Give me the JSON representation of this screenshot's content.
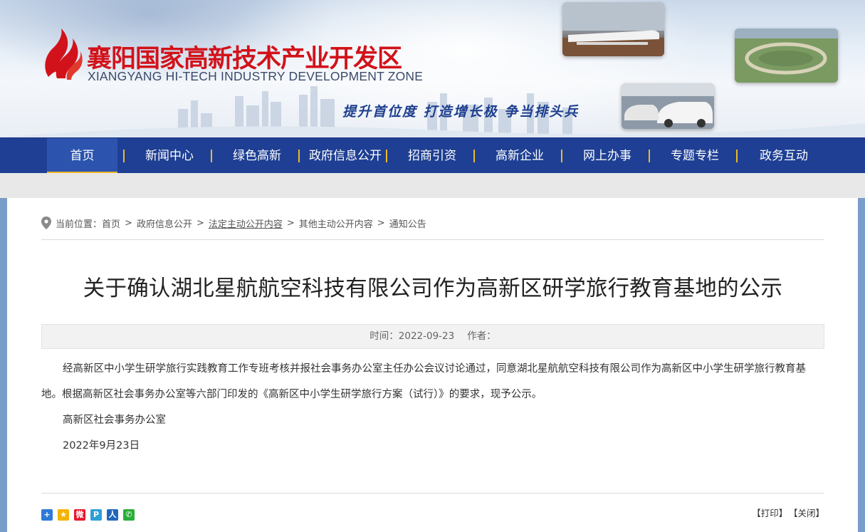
{
  "site": {
    "title_cn": "襄阳国家高新技术产业开发区",
    "title_en": "XIANGYANG HI-TECH INDUSTRY DEVELOPMENT ZONE",
    "slogan": "提升首位度  打造增长极  争当排头兵"
  },
  "nav": {
    "items": [
      {
        "label": "首页",
        "active": true
      },
      {
        "label": "新闻中心"
      },
      {
        "label": "绿色高新"
      },
      {
        "label": "政府信息公开"
      },
      {
        "label": "招商引资"
      },
      {
        "label": "高新企业"
      },
      {
        "label": "网上办事"
      },
      {
        "label": "专题专栏"
      },
      {
        "label": "政务互动"
      }
    ]
  },
  "breadcrumb": {
    "prefix": "当前位置：",
    "items": [
      "首页",
      "政府信息公开",
      "法定主动公开内容",
      "其他主动公开内容",
      "通知公告"
    ],
    "separator": ">"
  },
  "article": {
    "title": "关于确认湖北星航航空科技有限公司作为高新区研学旅行教育基地的公示",
    "time_label": "时间：",
    "time_value": "2022-09-23",
    "author_label": "作者：",
    "author_value": "",
    "paragraph": "经高新区中小学生研学旅行实践教育工作专班考核并报社会事务办公室主任办公会议讨论通过，同意湖北星航航空科技有限公司作为高新区中小学生研学旅行教育基地。根据高新区社会事务办公室等六部门印发的《高新区中小学生研学旅行方案（试行）》的要求，现予公示。",
    "signature": "高新区社会事务办公室",
    "date": "2022年9月23日"
  },
  "footer": {
    "print_label": "【打印】",
    "close_label": "【关闭】",
    "share_icons": [
      {
        "name": "share-more-icon",
        "color": "#2d7ad6",
        "glyph": "+"
      },
      {
        "name": "qzone-icon",
        "color": "#f3b400",
        "glyph": "★"
      },
      {
        "name": "weibo-icon",
        "color": "#e6162d",
        "glyph": "微"
      },
      {
        "name": "tencent-weibo-icon",
        "color": "#2d9fd8",
        "glyph": "P"
      },
      {
        "name": "renren-icon",
        "color": "#2266bb",
        "glyph": "人"
      },
      {
        "name": "wechat-icon",
        "color": "#2aae3a",
        "glyph": "✆"
      }
    ]
  },
  "colors": {
    "nav_bg": "#1e3f93",
    "nav_active": "#2c54ae",
    "accent": "#f0b92a",
    "title_red": "#d2121a"
  }
}
